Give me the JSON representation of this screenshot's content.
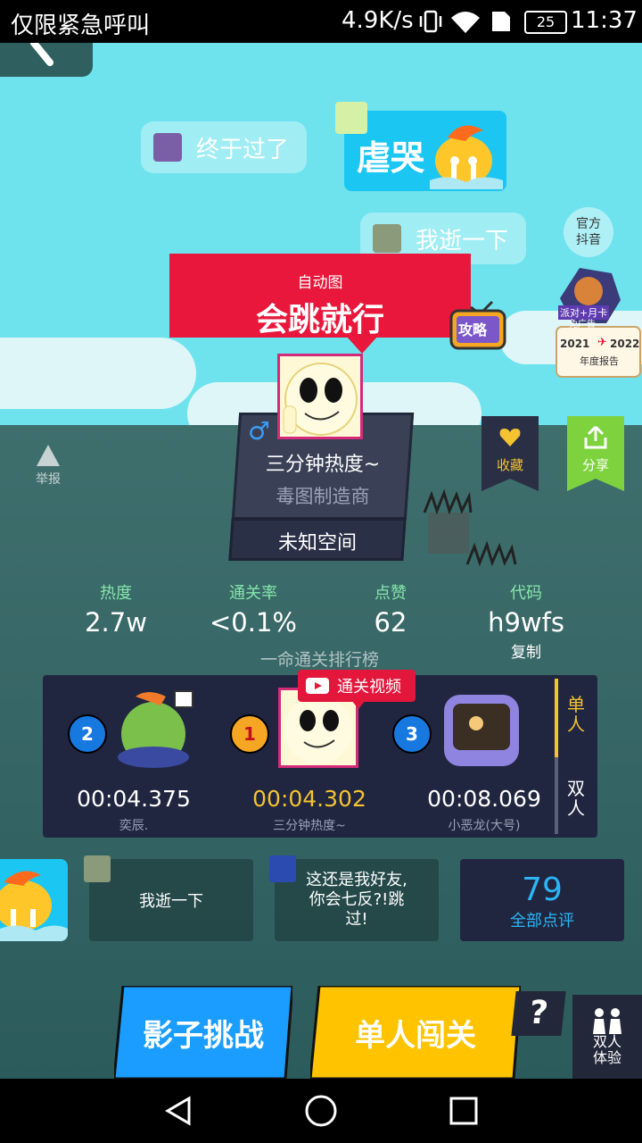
{
  "status_bar": {
    "left_text": "仅限紧急呼叫",
    "speed": "4.9K/s",
    "battery": "25",
    "time": "11:37"
  },
  "bubbles": {
    "finally_passed": "终于过了",
    "let_me_try": "我逝一下",
    "cry_card": "虐哭",
    "official_douyin": "官方\n抖音"
  },
  "level": {
    "tag": "自动图",
    "name": "会跳就行",
    "guide_label": "攻略",
    "pass_card": {
      "line1": "派对+月卡",
      "line2": "免广告",
      "year_from": "2021",
      "year_to": "2022",
      "report": "年度报告"
    }
  },
  "author": {
    "gender_symbol": "♂",
    "name": "三分钟热度~",
    "title": "毒图制造商",
    "space": "未知空间"
  },
  "actions": {
    "report": "举报",
    "favorite": "收藏",
    "share": "分享"
  },
  "stats": {
    "heat": {
      "label": "热度",
      "value": "2.7w"
    },
    "clear_rate": {
      "label": "通关率",
      "value": "<0.1%"
    },
    "likes": {
      "label": "点赞",
      "value": "62"
    },
    "code": {
      "label": "代码",
      "value": "h9wfs",
      "copy": "复制"
    }
  },
  "ranking": {
    "title": "一命通关排行榜",
    "video_tag": "通关视频",
    "entries": [
      {
        "rank": "2",
        "time": "00:04.375",
        "name": "奕辰."
      },
      {
        "rank": "1",
        "time": "00:04.302",
        "name": "三分钟热度~"
      },
      {
        "rank": "3",
        "time": "00:08.069",
        "name": "小恶龙(大号)"
      }
    ],
    "modes": [
      "单\n人",
      "双\n人"
    ]
  },
  "comments": {
    "c1": "我逝一下",
    "c2": "这还是我好友,\n你会七反?!跳\n过!",
    "count": "79",
    "all_label": "全部点评"
  },
  "buttons": {
    "shadow": "影子挑战",
    "single": "单人闯关",
    "help": "?",
    "duo": "双人\n体验"
  },
  "colors": {
    "sky": "#6ee3ee",
    "red": "#e8173b",
    "gold": "#f5c231",
    "blue_button": "#1aa2ff",
    "yellow_button": "#ffc300",
    "green_label": "#86e5ab"
  }
}
